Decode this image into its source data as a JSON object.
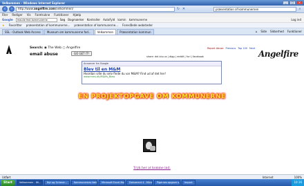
{
  "window": {
    "title": "Velkommen - Windows Internet Explorer",
    "controls": [
      "_",
      "□",
      "×"
    ]
  },
  "address": {
    "prefix": "http://www.",
    "domain": "angelfire.com",
    "suffix": "/velkommen/",
    "search_placeholder": "præsentation af kommunernen"
  },
  "menu": [
    "Filer",
    "Rediger",
    "Vis",
    "Foretrukne",
    "Funktioner",
    "Hjælp"
  ],
  "google_bar": {
    "logo": "Google",
    "query": "maude feal kommunerne",
    "items": [
      "Søg",
      "Bogmærker",
      "Kontroller",
      "AutoFyld",
      "kamin",
      "kommunerne"
    ],
    "login": "Log ind"
  },
  "favorites": {
    "label": "Favoritter",
    "items": [
      "præsentation af kommunerne...",
      "præsentation af kommunerne...",
      "Foreslåede websteder"
    ]
  },
  "tabs": [
    "SSL - Outlook Web Access",
    "Museum om kommunerne fod...",
    "Velkommen",
    "Præsentation kommun"
  ],
  "tab_tools": [
    "Side",
    "Sikkerhed",
    "Funktioner"
  ],
  "site": {
    "search_label": "Search:",
    "search_scope": "The Web",
    "search_brand": "Angelfire",
    "email_label": "email abuse",
    "get_it_button": "GO GET IT!",
    "top_links": [
      "Report Abuse",
      "Previous",
      "Top 100",
      "Next"
    ],
    "share_links": "share: del.icio.us | digg | reddit | furl | facebook",
    "logo": "Angelfire"
  },
  "ad": {
    "header": "Annoncer fra Google",
    "title": "Blev til en M&M",
    "text": "Hvordan ville du selv finde du var M&M? Find ud af det her!",
    "url": "www.mms.dk/M&Ms_Blaw"
  },
  "headline": "EN PROJEKTOPGAVE OM KOMMUNERNE",
  "page_link": "Tryk her at komme ind.",
  "status": {
    "left": "Udført",
    "zone": "Internet",
    "zoom": "100%"
  },
  "taskbar": {
    "start": "Start",
    "tasks": [
      "Velkommen - Wi...",
      "Nyt og Scherer...",
      "Kommunernes fældt...",
      "Microsoft Excel-Mo...",
      "Dokument 4 - Micro...",
      "Pigernes opgave s...",
      "Import"
    ],
    "clock": "10:16"
  }
}
